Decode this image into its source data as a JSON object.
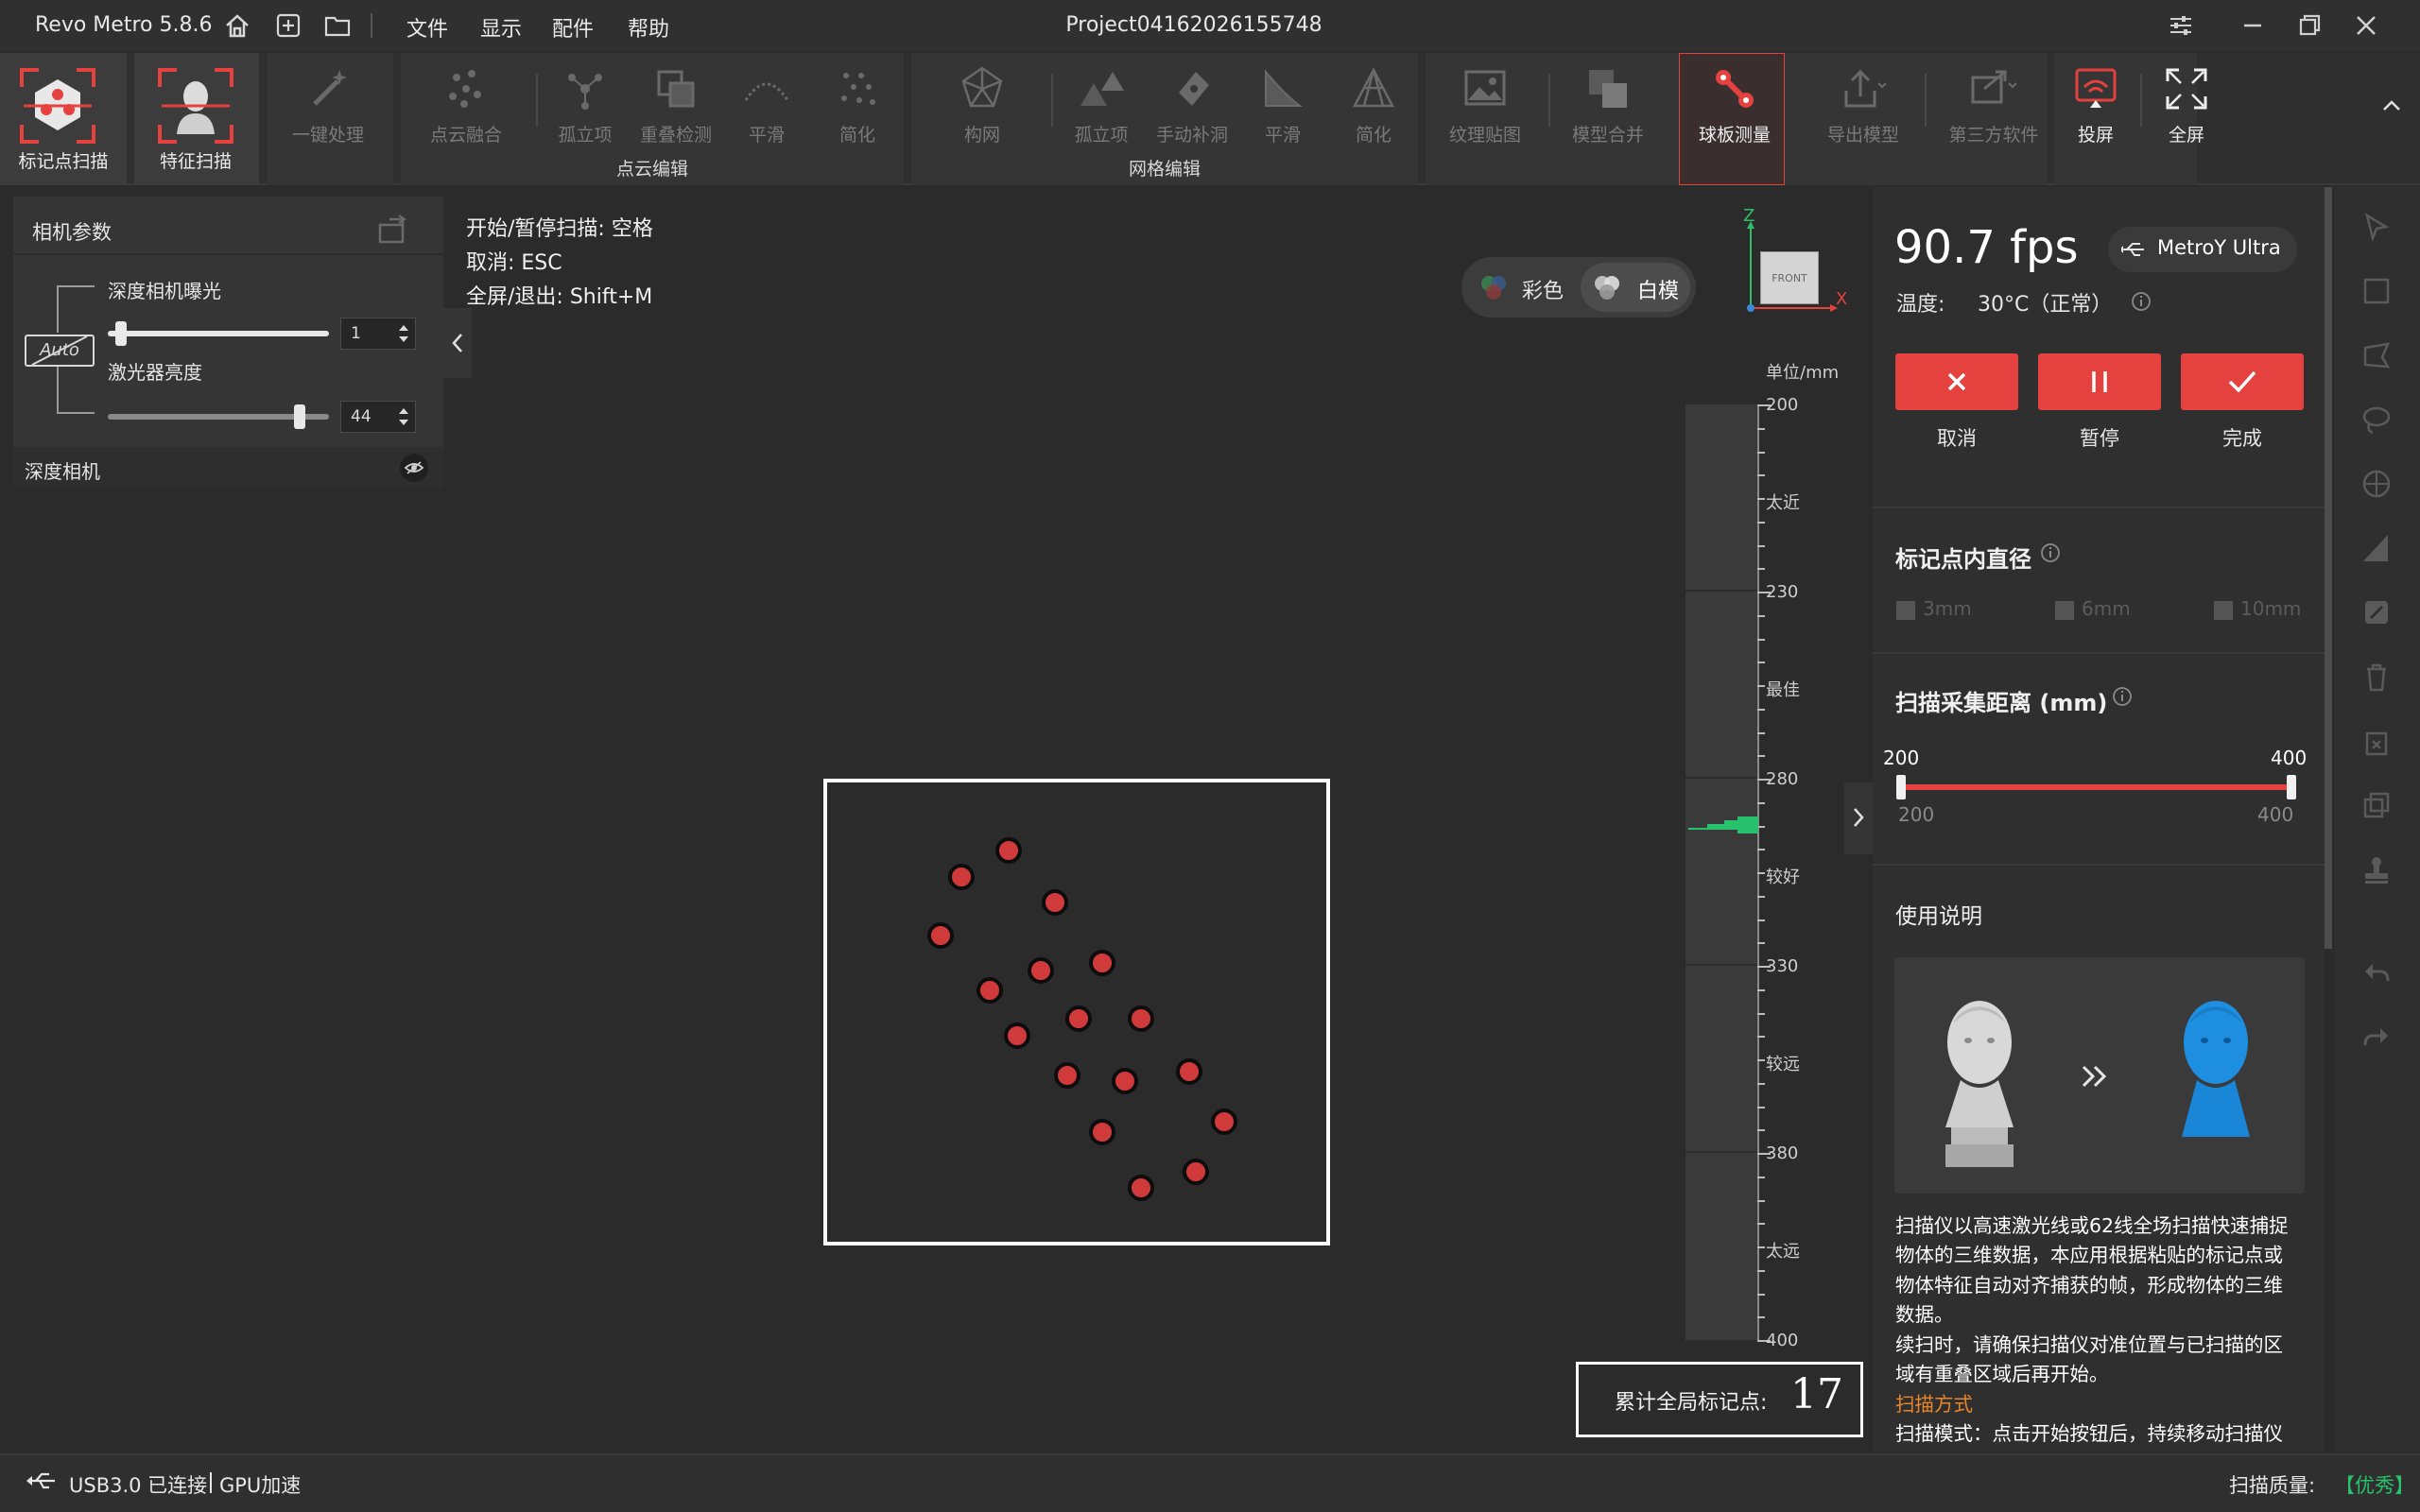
{
  "titlebar": {
    "app_title": "Revo Metro 5.8.6",
    "project_name": "Project04162026155748",
    "menu": [
      "文件",
      "显示",
      "配件",
      "帮助"
    ]
  },
  "ribbon": {
    "marker_scan": "标记点扫描",
    "feature_scan": "特征扫描",
    "one_click": "一键处理",
    "pc_fuse": "点云融合",
    "pc_isolated": "孤立项",
    "pc_overlap": "重叠检测",
    "pc_smooth": "平滑",
    "pc_simplify": "简化",
    "group_pointcloud": "点云编辑",
    "mesh_build": "构网",
    "mesh_isolated": "孤立项",
    "mesh_fill": "手动补洞",
    "mesh_smooth": "平滑",
    "mesh_simplify": "简化",
    "group_mesh": "网格编辑",
    "texture": "纹理贴图",
    "merge": "模型合并",
    "ball_measure": "球板测量",
    "export": "导出模型",
    "third_party": "第三方软件",
    "cast": "投屏",
    "fullscreen": "全屏"
  },
  "camera_panel": {
    "title": "相机参数",
    "exposure_label": "深度相机曝光",
    "exposure_value": "1",
    "exposure_level": 0.0,
    "laser_label": "激光器亮度",
    "laser_value": "44",
    "laser_level": 0.86,
    "auto_label": "Auto",
    "depth_camera": "深度相机"
  },
  "hints": {
    "start_pause": "开始/暂停扫描: 空格",
    "cancel": "取消: ESC",
    "fullscreen": "全屏/退出: Shift+M"
  },
  "view_toggle": {
    "color": "彩色",
    "white": "白模"
  },
  "axis": {
    "z": "Z",
    "x": "X",
    "front": "FRONT"
  },
  "ruler": {
    "unit": "单位/mm",
    "ticks": [
      "200",
      "230",
      "280",
      "330",
      "380",
      "400"
    ],
    "zones": [
      "太近",
      "最佳",
      "较好",
      "较远",
      "太远"
    ]
  },
  "marker_count": {
    "label": "累计全局标记点:",
    "value": "17"
  },
  "right_panel": {
    "fps": "90.7 fps",
    "device": "MetroY Ultra",
    "temp_label": "温度:",
    "temp_value": "30°C（正常）",
    "cancel": "取消",
    "pause": "暂停",
    "done": "完成",
    "marker_diameter_title": "标记点内直径",
    "diameters": [
      "3mm",
      "6mm",
      "10mm"
    ],
    "distance_title": "扫描采集距离 (mm)",
    "range_min_top": "200",
    "range_max_top": "400",
    "range_min_bottom": "200",
    "range_max_bottom": "400",
    "instructions_title": "使用说明",
    "desc_line1": "扫描仪以高速激光线或62线全场扫描快速捕捉",
    "desc_line2": "物体的三维数据，本应用根据粘贴的标记点或",
    "desc_line3": "物体特征自动对齐捕获的帧，形成物体的三维",
    "desc_line4": "数据。",
    "desc_line5": "续扫时，请确保扫描仪对准位置与已扫描的区",
    "desc_line6": "域有重叠区域后再开始。",
    "scan_mode_title": "扫描方式",
    "desc_line7": "扫描模式：点击开始按钮后，持续移动扫描仪"
  },
  "statusbar": {
    "usb": "USB3.0 已连接",
    "gpu": "GPU加速",
    "quality_label": "扫描质量:",
    "quality_value": "【优秀】"
  },
  "colors": {
    "accent_red": "#e4413f",
    "good_green": "#27c26b",
    "highlight_orange": "#e8862a"
  }
}
